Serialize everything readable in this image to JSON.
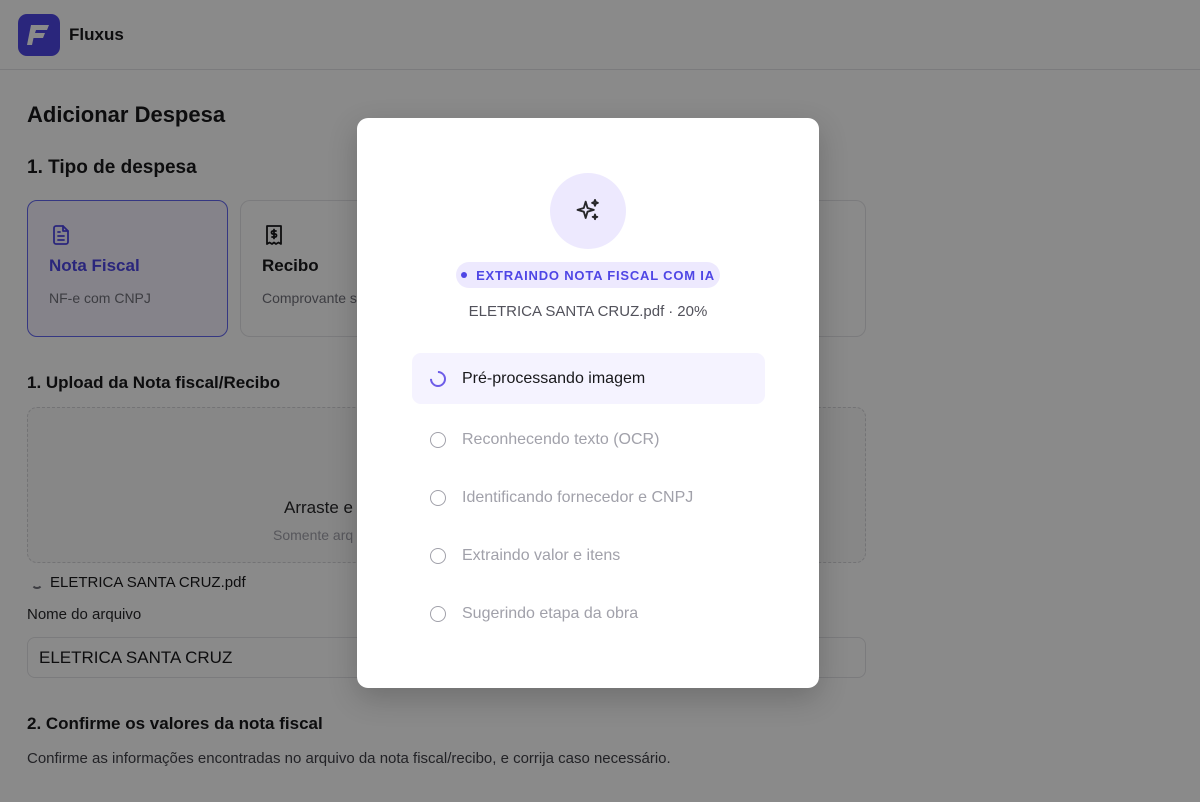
{
  "app": {
    "name": "Fluxus"
  },
  "page": {
    "title": "Adicionar Despesa"
  },
  "sections": {
    "tipo": "1. Tipo de despesa",
    "upload": "1. Upload da Nota fiscal/Recibo",
    "confirm": "2. Confirme os valores da nota fiscal",
    "confirm_desc": "Confirme as informações encontradas no arquivo da nota fiscal/recibo, e corrija caso necessário."
  },
  "expense_types": [
    {
      "title": "Nota Fiscal",
      "subtitle": "NF-e com CNPJ",
      "icon": "document-icon",
      "selected": true
    },
    {
      "title": "Recibo",
      "subtitle": "Comprovante s",
      "icon": "receipt-icon",
      "selected": false
    }
  ],
  "dropzone": {
    "main": "Arraste e",
    "sub": "Somente arq"
  },
  "uploaded_file": {
    "name": "ELETRICA SANTA CRUZ.pdf"
  },
  "filename_field": {
    "label": "Nome do arquivo",
    "value": "ELETRICA SANTA CRUZ"
  },
  "modal": {
    "icon": "sparkles-icon",
    "badge": "EXTRAINDO NOTA FISCAL COM IA",
    "file": "ELETRICA SANTA CRUZ.pdf",
    "separator": "·",
    "progress": "20%",
    "steps": [
      {
        "label": "Pré-processando imagem",
        "status": "active"
      },
      {
        "label": "Reconhecendo texto (OCR)",
        "status": "pending"
      },
      {
        "label": "Identificando fornecedor e CNPJ",
        "status": "pending"
      },
      {
        "label": "Extraindo valor e itens",
        "status": "pending"
      },
      {
        "label": "Sugerindo etapa da obra",
        "status": "pending"
      }
    ]
  },
  "colors": {
    "accent": "#4f46e5",
    "accent_soft": "#ede9fe",
    "selected_bg": "#f5f3ff"
  }
}
